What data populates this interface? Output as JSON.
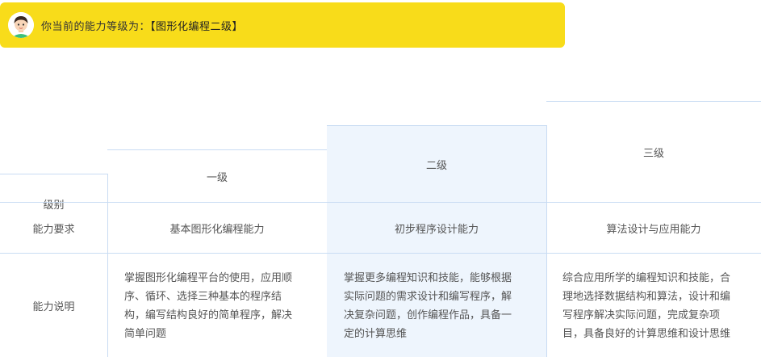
{
  "banner": {
    "text": "你当前的能力等级为：",
    "level": "【图形化编程二级】"
  },
  "table": {
    "header_label": "级别",
    "columns": [
      "一级",
      "二级",
      "三级"
    ],
    "highlight_column": "二级",
    "rows": [
      {
        "label": "能力要求",
        "cells": [
          "基本图形化编程能力",
          "初步程序设计能力",
          "算法设计与应用能力"
        ]
      },
      {
        "label": "能力说明",
        "cells": [
          [
            "掌握图形化编程平台的使用，应用顺",
            "序、循环、选择三种基本的程序结",
            "构，编写结构良好的简单程序，解决",
            "简单问题"
          ],
          [
            "掌握更多编程知识和技能，能够根据",
            "实际问题的需求设计和编写程序，解",
            "决复杂问题，创作编程作品，具备一",
            "定的计算思维"
          ],
          [
            "综合应用所学的编程知识和技能，合",
            "理地选择数据结构和算法，设计和编",
            "写程序解决实际问题，完成复杂项",
            "目，具备良好的计算思维和设计思维"
          ]
        ]
      }
    ]
  },
  "colors": {
    "banner": "#f8dc1a",
    "border": "#c9dcf3",
    "highlight": "#eef5fd"
  }
}
